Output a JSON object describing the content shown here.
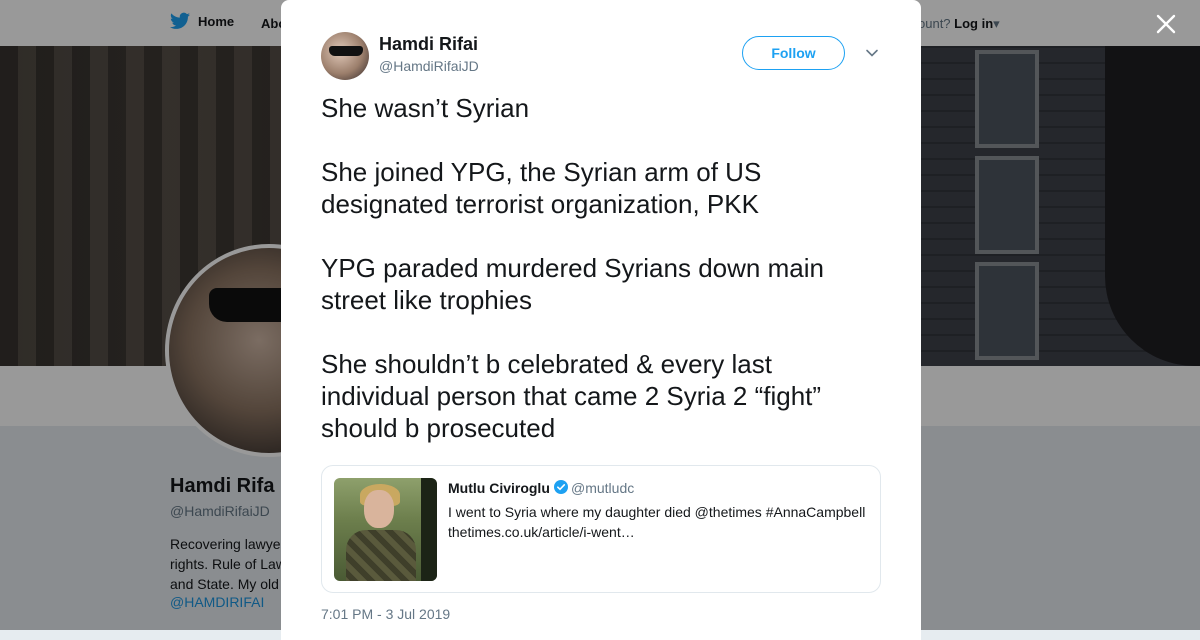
{
  "background": {
    "nav": {
      "home": "Home",
      "about_partial": "Abo",
      "account_partial": "ccount?",
      "login": "Log in"
    },
    "profile": {
      "name_partial": "Hamdi Rifa",
      "handle": "@HamdiRifaiJD",
      "bio_lines": [
        "Recovering lawye",
        "rights. Rule of Law",
        "and State. My old"
      ],
      "link": "@HAMDIRIFAI"
    }
  },
  "tweet": {
    "author_name": "Hamdi Rifai",
    "author_handle": "@HamdiRifaiJD",
    "follow_label": "Follow",
    "text": "She wasn’t Syrian\n\nShe joined YPG, the Syrian arm of US designated terrorist organization, PKK\n\nYPG paraded murdered Syrians down main street like trophies\n\nShe shouldn’t b celebrated & every last individual person that came 2 Syria 2 “fight” should b prosecuted",
    "quoted": {
      "name": "Mutlu Civiroglu",
      "handle": "@mutludc",
      "text": "I went to Syria where my daughter died @thetimes #AnnaCampbell thetimes.co.uk/article/i-went…"
    },
    "timestamp": "7:01 PM - 3 Jul 2019"
  },
  "colors": {
    "accent": "#1da1f2",
    "text": "#14171a",
    "muted": "#657786"
  }
}
